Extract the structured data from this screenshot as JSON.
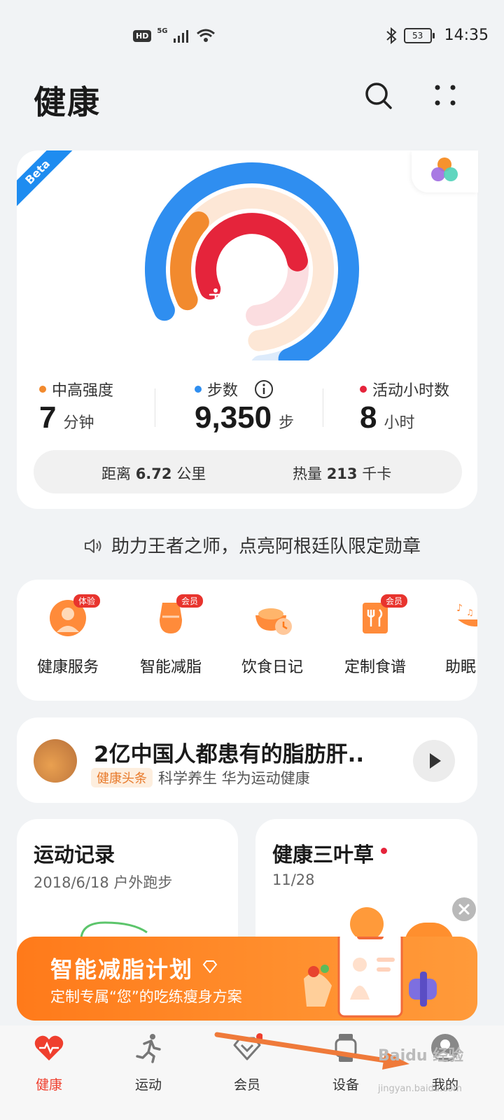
{
  "status_bar": {
    "hd": "HD",
    "network": "5G",
    "battery": "53",
    "time": "14:35"
  },
  "header": {
    "title": "健康",
    "search_icon": "search-icon",
    "more_icon": "more-grid-icon"
  },
  "activity": {
    "beta": "Beta",
    "stats": [
      {
        "label": "中高强度",
        "value": "7",
        "unit": "分钟",
        "color": "#f28a2e"
      },
      {
        "label": "步数",
        "value": "9,350",
        "unit": "步",
        "color": "#2f8ef0"
      },
      {
        "label": "活动小时数",
        "value": "8",
        "unit": "小时",
        "color": "#e5243b"
      }
    ],
    "info_icon": "info-icon",
    "distance_label": "距离",
    "distance_value": "6.72",
    "distance_unit": "公里",
    "calories_label": "热量",
    "calories_value": "213",
    "calories_unit": "千卡",
    "rings": {
      "steps_progress": 0.94,
      "intensity_progress": 0.23,
      "hours_progress": 0.67
    }
  },
  "notice": "助力王者之师，点亮阿根廷队限定勋章",
  "services": [
    {
      "label": "健康服务",
      "tag": "体验"
    },
    {
      "label": "智能减脂",
      "tag": "会员"
    },
    {
      "label": "饮食日记",
      "tag": ""
    },
    {
      "label": "定制食谱",
      "tag": "会员"
    },
    {
      "label": "助眠",
      "tag": ""
    }
  ],
  "article": {
    "title": "2亿中国人都患有的脂肪肝..",
    "tag": "健康头条",
    "source": "科学养生 华为运动健康"
  },
  "record_card": {
    "title": "运动记录",
    "subtitle": "2018/6/18 户外跑步"
  },
  "clover_card": {
    "title": "健康三叶草",
    "subtitle": "11/28"
  },
  "banner": {
    "title": "智能减脂计划",
    "subtitle": "定制专属“您”的吃练瘦身方案"
  },
  "tabs": [
    {
      "label": "健康",
      "active": true
    },
    {
      "label": "运动",
      "active": false
    },
    {
      "label": "会员",
      "active": false
    },
    {
      "label": "设备",
      "active": false
    },
    {
      "label": "我的",
      "active": false
    }
  ],
  "watermark": "Baidu 经验",
  "watermark_url": "jingyan.baidu.com"
}
